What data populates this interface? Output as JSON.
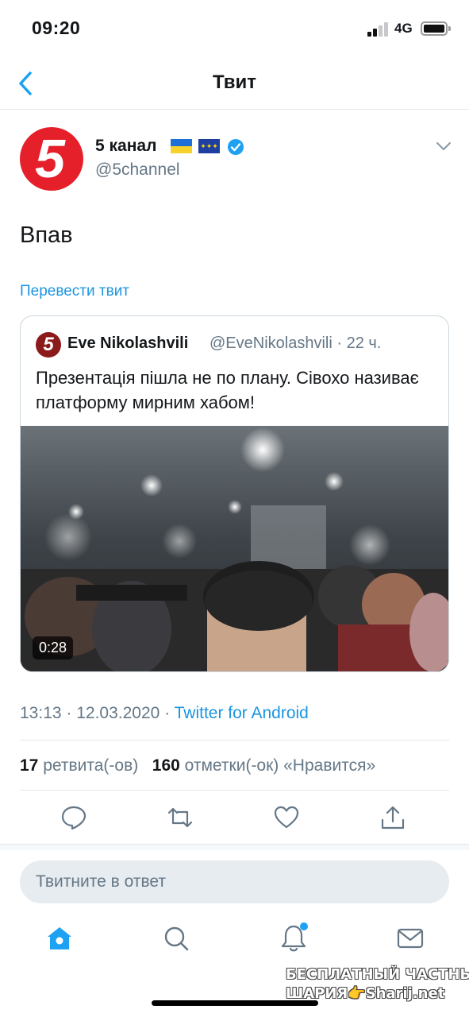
{
  "status_bar": {
    "time": "09:20",
    "network": "4G"
  },
  "nav": {
    "title": "Твит"
  },
  "tweet": {
    "author_name": "5 канал",
    "author_handle": "@5channel",
    "text": "Впав",
    "translate_label": "Перевести твит",
    "timestamp": "13:13 · 12.03.2020 · ",
    "source": "Twitter for Android",
    "retweet_count": "17",
    "retweet_label": "ретвита(-ов)",
    "like_count": "160",
    "like_label": "отметки(-ок) «Нравится»"
  },
  "quoted_tweet": {
    "author_name": "Eve Nikolashvili",
    "author_handle": "@EveNikolashvili · 22 ч.",
    "text": "Презентація пішла не по плану. Сівохо називає платформу мирним хабом!",
    "video_duration": "0:28"
  },
  "reply": {
    "placeholder": "Твитните в ответ"
  },
  "icons": {
    "back": "chevron-left-icon",
    "reply": "reply-icon",
    "retweet": "retweet-icon",
    "like": "heart-icon",
    "share": "share-icon",
    "tab_home": "home-icon",
    "tab_search": "search-icon",
    "tab_notifications": "bell-icon",
    "tab_messages": "mail-icon"
  },
  "watermark": {
    "line1": "БЕСПЛАТНЫЙ ЧАСТНЫЙ",
    "line2": "ШАРИЯ👉Sharij.net"
  },
  "colors": {
    "accent": "#1b95e0",
    "secondary_text": "#657786",
    "channel_red": "#e5202a"
  }
}
